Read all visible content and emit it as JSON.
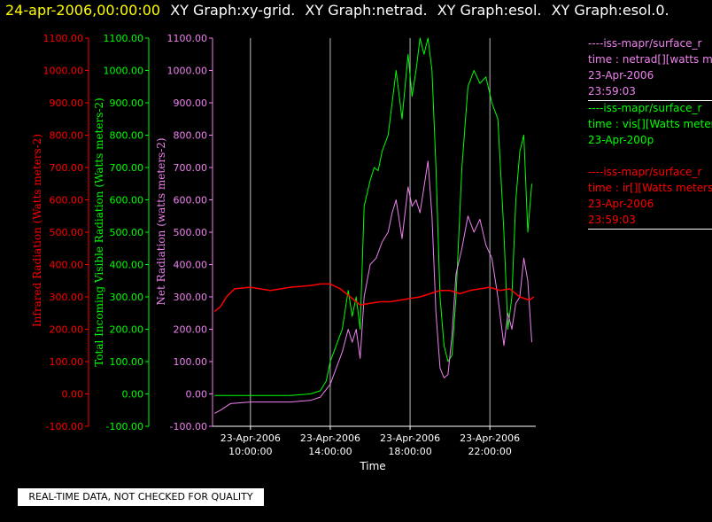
{
  "title_bar": {
    "date": "24-apr-2006,00:00:00",
    "tags": [
      "XY Graph:xy-grid.",
      "XY Graph:netrad.",
      "XY Graph:esol.",
      "XY Graph:esol.0."
    ]
  },
  "colors": {
    "infrared": "#ff0000",
    "visible": "#00ff00",
    "net": "#ee82ee",
    "axis": "#ffffff"
  },
  "legend": [
    {
      "name": "----iss-mapr/surface_r",
      "line2": "time : netrad[][watts m",
      "line3": "23-Apr-2006",
      "line4": "23:59:03",
      "color": "#ee82ee"
    },
    {
      "name": "----iss-mapr/surface_r",
      "line2": "time : vis[][Watts meter",
      "line3": "23-Apr-200p",
      "line4": "",
      "color": "#00ff00"
    },
    {
      "name": "----iss-mapr/surface_r",
      "line2": "time : ir[][Watts meters",
      "line3": "23-Apr-2006",
      "line4": "23:59:03",
      "color": "#ff0000"
    }
  ],
  "notice": "REAL-TIME DATA, NOT CHECKED FOR QUALITY",
  "chart_data": {
    "type": "line",
    "xlabel": "Time",
    "x_ticks": [
      {
        "date": "23-Apr-2006",
        "time": "10:00:00",
        "hour": 10
      },
      {
        "date": "23-Apr-2006",
        "time": "14:00:00",
        "hour": 14
      },
      {
        "date": "23-Apr-2006",
        "time": "18:00:00",
        "hour": 18
      },
      {
        "date": "23-Apr-2006",
        "time": "22:00:00",
        "hour": 22
      }
    ],
    "xlim_hours": [
      8.1,
      24.3
    ],
    "grid": "vertical lines at x ticks",
    "axes": [
      {
        "label": "Infrared Radiation (Watts meters-2)",
        "color": "#ff0000",
        "ylim": [
          -100,
          1100
        ]
      },
      {
        "label": "Total Incoming Visible Radiation (Watts meters-2)",
        "color": "#00ff00",
        "ylim": [
          -100,
          1100
        ]
      },
      {
        "label": "Net Radiation (watts meters-2)",
        "color": "#ee82ee",
        "ylim": [
          -100,
          1100
        ]
      }
    ],
    "y_ticks": [
      -100,
      0,
      100,
      200,
      300,
      400,
      500,
      600,
      700,
      800,
      900,
      1000,
      1100
    ],
    "tick_labels": [
      "-100.00",
      "0.00",
      "100.00",
      "200.00",
      "300.00",
      "400.00",
      "500.00",
      "600.00",
      "700.00",
      "800.00",
      "900.00",
      "1000.00",
      "1100.00"
    ],
    "series": [
      {
        "key": "visible",
        "color": "#00ff00",
        "x": [
          8.2,
          9,
          10,
          11,
          12,
          13,
          13.5,
          13.8,
          14,
          14.3,
          14.6,
          14.9,
          15.1,
          15.3,
          15.5,
          15.7,
          16,
          16.2,
          16.4,
          16.6,
          16.9,
          17.1,
          17.3,
          17.6,
          17.9,
          18.1,
          18.3,
          18.5,
          18.7,
          18.9,
          19.1,
          19.3,
          19.5,
          19.7,
          19.9,
          20.1,
          20.3,
          20.6,
          20.9,
          21.2,
          21.5,
          21.8,
          22.1,
          22.4,
          22.7,
          22.9,
          23.1,
          23.3,
          23.5,
          23.7,
          23.9,
          24.1
        ],
        "values": [
          -5,
          -5,
          -5,
          -5,
          -5,
          0,
          10,
          40,
          100,
          150,
          200,
          320,
          240,
          300,
          200,
          580,
          660,
          700,
          690,
          750,
          800,
          900,
          1000,
          850,
          1050,
          920,
          1000,
          1100,
          1050,
          1100,
          1000,
          700,
          300,
          150,
          100,
          120,
          300,
          700,
          950,
          1000,
          960,
          980,
          900,
          850,
          500,
          200,
          300,
          600,
          750,
          800,
          500,
          650
        ]
      },
      {
        "key": "net",
        "color": "#ee82ee",
        "x": [
          8.2,
          8.5,
          9,
          10,
          11,
          12,
          13,
          13.5,
          14,
          14.3,
          14.6,
          14.9,
          15.1,
          15.3,
          15.5,
          15.7,
          16,
          16.3,
          16.6,
          16.9,
          17.1,
          17.3,
          17.6,
          17.9,
          18.1,
          18.3,
          18.5,
          18.7,
          18.9,
          19.1,
          19.3,
          19.5,
          19.7,
          19.9,
          20.1,
          20.3,
          20.6,
          20.9,
          21.2,
          21.5,
          21.8,
          22.1,
          22.4,
          22.7,
          22.9,
          23.1,
          23.3,
          23.5,
          23.7,
          23.9,
          24.1
        ],
        "values": [
          -60,
          -50,
          -30,
          -25,
          -25,
          -25,
          -20,
          -10,
          30,
          80,
          130,
          200,
          160,
          200,
          110,
          300,
          400,
          420,
          470,
          500,
          560,
          600,
          480,
          640,
          580,
          600,
          560,
          640,
          720,
          550,
          250,
          80,
          50,
          60,
          180,
          370,
          450,
          550,
          500,
          540,
          460,
          420,
          300,
          150,
          250,
          200,
          280,
          300,
          420,
          350,
          160
        ]
      },
      {
        "key": "infrared",
        "color": "#ff0000",
        "x": [
          8.2,
          8.5,
          8.8,
          9.2,
          10,
          11,
          12,
          13,
          13.5,
          14,
          14.5,
          15,
          15.5,
          16,
          16.5,
          17,
          17.5,
          18,
          18.5,
          19,
          19.5,
          20,
          20.5,
          21,
          21.5,
          22,
          22.5,
          23,
          23.5,
          24,
          24.2
        ],
        "values": [
          255,
          270,
          300,
          325,
          330,
          320,
          330,
          335,
          340,
          340,
          325,
          300,
          275,
          280,
          285,
          285,
          290,
          295,
          300,
          310,
          320,
          320,
          310,
          320,
          325,
          330,
          320,
          325,
          300,
          290,
          300
        ]
      }
    ]
  }
}
